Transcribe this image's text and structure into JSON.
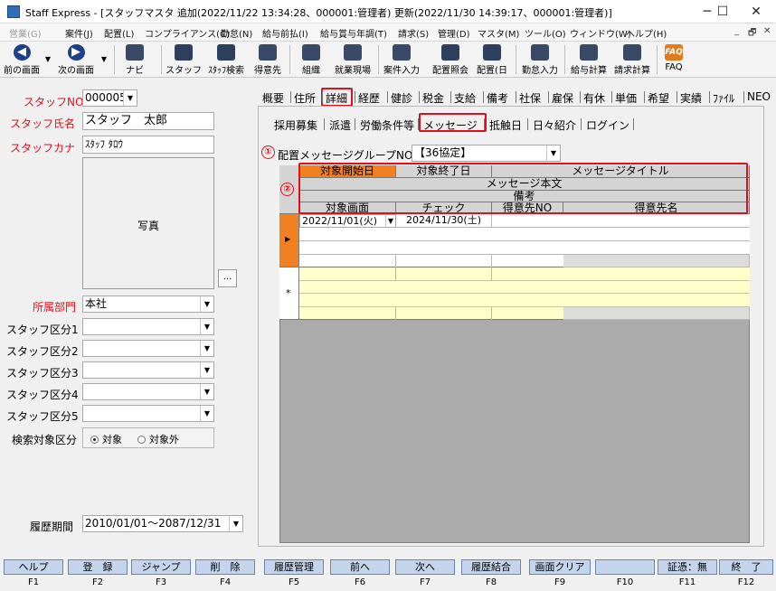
{
  "window": {
    "title": "Staff Express - [スタッフマスタ 追加(2022/11/22 13:34:28、000001:管理者) 更新(2022/11/30 14:39:17、000001:管理者)]",
    "min": "─",
    "max": "☐",
    "close": "✕"
  },
  "menubar": {
    "items": [
      {
        "label": "営業(G)",
        "disabled": true
      },
      {
        "label": "案件(J)"
      },
      {
        "label": "配置(L)"
      },
      {
        "label": "コンプライアンス(C)"
      },
      {
        "label": "勤怠(N)"
      },
      {
        "label": "給与前払(I)"
      },
      {
        "label": "給与賞与年調(T)"
      },
      {
        "label": "請求(S)"
      },
      {
        "label": "管理(D)"
      },
      {
        "label": "マスタ(M)"
      },
      {
        "label": "ツール(O)"
      },
      {
        "label": "ウィンドウ(W)"
      },
      {
        "label": "ヘルプ(H)"
      }
    ],
    "mdi": [
      "_",
      "🗗",
      "✕"
    ]
  },
  "toolbar": {
    "buttons": [
      {
        "label": "前の画面",
        "icon": "arrow-left-icon"
      },
      {
        "label": "次の画面",
        "icon": "arrow-right-icon"
      },
      {
        "label": "ナビ",
        "icon": "navi-icon"
      },
      {
        "label": "スタッフ",
        "icon": "staff-icon"
      },
      {
        "label": "ｽﾀｯﾌ検索",
        "icon": "staff-search-icon"
      },
      {
        "label": "得意先",
        "icon": "client-icon"
      },
      {
        "label": "組織",
        "icon": "organization-icon"
      },
      {
        "label": "就業現場",
        "icon": "worksite-icon"
      },
      {
        "label": "案件入力",
        "icon": "job-input-icon"
      },
      {
        "label": "配置照会",
        "icon": "placement-inquiry-icon"
      },
      {
        "label": "配置(日",
        "icon": "placement-daily-icon"
      },
      {
        "label": "勤怠入力",
        "icon": "attendance-input-icon"
      },
      {
        "label": "給与計算",
        "icon": "payroll-icon"
      },
      {
        "label": "請求計算",
        "icon": "billing-icon"
      },
      {
        "label": "FAQ",
        "icon": "faq-icon"
      }
    ]
  },
  "form": {
    "staff_no_label": "スタッフNO",
    "staff_no": "000005",
    "staff_name_label": "スタッフ氏名",
    "staff_name": "スタッフ　太郎",
    "staff_kana_label": "スタッフカナ",
    "staff_kana": "ｽﾀｯﾌ ﾀﾛｳ",
    "photo_label": "写真",
    "photo_button": "...",
    "dept_label": "所属部門",
    "dept": "本社",
    "categories": [
      {
        "label": "スタッフ区分1",
        "value": ""
      },
      {
        "label": "スタッフ区分2",
        "value": ""
      },
      {
        "label": "スタッフ区分3",
        "value": ""
      },
      {
        "label": "スタッフ区分4",
        "value": ""
      },
      {
        "label": "スタッフ区分5",
        "value": ""
      }
    ],
    "search_target_label": "検索対象区分",
    "radio_target": "対象",
    "radio_not_target": "対象外",
    "history_label": "履歴期間",
    "history_period": "2010/01/01～2087/12/31"
  },
  "tabs_main": [
    "概要",
    "住所",
    "詳細",
    "経歴",
    "健診",
    "税金",
    "支給",
    "備考",
    "社保",
    "雇保",
    "有休",
    "単価",
    "希望",
    "実績",
    "ﾌｧｲﾙ",
    "NEO"
  ],
  "tabs_sub": [
    "採用募集",
    "派遣",
    "労働条件等",
    "メッセージ",
    "抵触日",
    "日々紹介",
    "ログイン"
  ],
  "message": {
    "marker1": "①",
    "marker2": "②",
    "group_label": "配置メッセージグループNO",
    "group_value": "【36協定】",
    "headers": {
      "start": "対象開始日",
      "end": "対象終了日",
      "title": "メッセージタイトル",
      "body": "メッセージ本文",
      "remarks": "備考",
      "screen": "対象画面",
      "check": "チェック",
      "client_no": "得意先NO",
      "client_name": "得意先名"
    },
    "row1": {
      "start": "2022/11/01(火)",
      "end": "2024/11/30(土)"
    },
    "new_row_marker": "*",
    "current_row_marker": "▶"
  },
  "fkeys": [
    {
      "label": "ヘルプ",
      "key": "F1"
    },
    {
      "label": "登　録",
      "key": "F2"
    },
    {
      "label": "ジャンプ",
      "key": "F3"
    },
    {
      "label": "削　除",
      "key": "F4"
    },
    {
      "label": "履歴管理",
      "key": "F5"
    },
    {
      "label": "前へ",
      "key": "F6"
    },
    {
      "label": "次へ",
      "key": "F7"
    },
    {
      "label": "履歴結合",
      "key": "F8"
    },
    {
      "label": "画面クリア",
      "key": "F9"
    },
    {
      "label": "",
      "key": "F10"
    },
    {
      "label": "証憑：無",
      "key": "F11"
    },
    {
      "label": "終　了",
      "key": "F12"
    }
  ],
  "colors": {
    "required_label": "#e0101a",
    "active_header": "#f08020",
    "highlight": "#e0101a",
    "new_row": "#ffffcc",
    "fkey_bg": "#c4d4ec"
  }
}
